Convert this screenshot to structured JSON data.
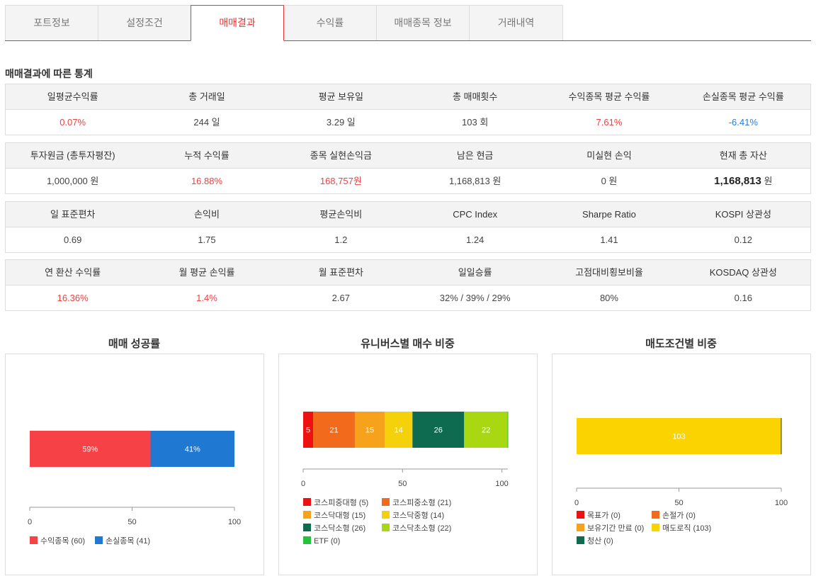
{
  "tabs": [
    {
      "label": "포트정보",
      "active": false
    },
    {
      "label": "설정조건",
      "active": false
    },
    {
      "label": "매매결과",
      "active": true
    },
    {
      "label": "수익률",
      "active": false
    },
    {
      "label": "매매종목 정보",
      "active": false
    },
    {
      "label": "거래내역",
      "active": false
    }
  ],
  "section_title": "매매결과에 따른 통계",
  "stats": [
    {
      "headers": [
        "일평균수익률",
        "총 거래일",
        "평균 보유일",
        "총 매매횟수",
        "수익종목 평균 수익률",
        "손실종목 평균 수익률"
      ],
      "values": [
        {
          "text": "0.07%",
          "style": "red"
        },
        {
          "text": "244 일",
          "style": ""
        },
        {
          "text": "3.29 일",
          "style": ""
        },
        {
          "text": "103 회",
          "style": ""
        },
        {
          "text": "7.61%",
          "style": "red"
        },
        {
          "text": "-6.41%",
          "style": "blue"
        }
      ]
    },
    {
      "headers": [
        "투자원금 (총투자평잔)",
        "누적 수익률",
        "종목 실현손익금",
        "남은 현금",
        "미실현 손익",
        "현재 총 자산"
      ],
      "values": [
        {
          "text": "1,000,000 원",
          "style": ""
        },
        {
          "text": "16.88%",
          "style": "red"
        },
        {
          "text": "168,757원",
          "style": "red"
        },
        {
          "text": "1,168,813 원",
          "style": ""
        },
        {
          "text": "0 원",
          "style": ""
        },
        {
          "text": "1,168,813",
          "unit": " 원",
          "style": "bold"
        }
      ]
    },
    {
      "headers": [
        "일 표준편차",
        "손익비",
        "평균손익비",
        "CPC Index",
        "Sharpe Ratio",
        "KOSPI 상관성"
      ],
      "values": [
        {
          "text": "0.69",
          "style": ""
        },
        {
          "text": "1.75",
          "style": ""
        },
        {
          "text": "1.2",
          "style": ""
        },
        {
          "text": "1.24",
          "style": ""
        },
        {
          "text": "1.41",
          "style": ""
        },
        {
          "text": "0.12",
          "style": ""
        }
      ]
    },
    {
      "headers": [
        "연 환산 수익률",
        "월 평균 손익률",
        "월 표준편차",
        "일일승률",
        "고점대비횡보비율",
        "KOSDAQ 상관성"
      ],
      "values": [
        {
          "text": "16.36%",
          "style": "red"
        },
        {
          "text": "1.4%",
          "style": "red"
        },
        {
          "text": "2.67",
          "style": ""
        },
        {
          "text": "32% / 39% / 29%",
          "style": ""
        },
        {
          "text": "80%",
          "style": ""
        },
        {
          "text": "0.16",
          "style": ""
        }
      ]
    }
  ],
  "charts": [
    {
      "title": "매매 성공률",
      "chart_data": {
        "type": "bar",
        "orientation": "horizontal-stacked",
        "xlim": [
          0,
          100
        ],
        "ticks": [
          0,
          50,
          100
        ],
        "segments": [
          {
            "name": "수익종목",
            "value": 59,
            "count": 60,
            "label": "59%",
            "color": "#f64146"
          },
          {
            "name": "손실종목",
            "value": 41,
            "count": 41,
            "label": "41%",
            "color": "#1f78d1"
          }
        ],
        "legend": [
          "수익종목 (60)",
          "손실종목 (41)"
        ]
      }
    },
    {
      "title": "유니버스별 매수 비중",
      "chart_data": {
        "type": "bar",
        "orientation": "horizontal-stacked",
        "xlim": [
          0,
          103
        ],
        "ticks": [
          0,
          50,
          100
        ],
        "segments": [
          {
            "name": "코스피중대형",
            "value": 5,
            "label": "5",
            "color": "#ee1111"
          },
          {
            "name": "코스피중소형",
            "value": 21,
            "label": "21",
            "color": "#f26a1b"
          },
          {
            "name": "코스닥대형",
            "value": 15,
            "label": "15",
            "color": "#f7a21b"
          },
          {
            "name": "코스닥중형",
            "value": 14,
            "label": "14",
            "color": "#f5d10c"
          },
          {
            "name": "코스닥소형",
            "value": 26,
            "label": "26",
            "color": "#0e6b50"
          },
          {
            "name": "코스닥초소형",
            "value": 22,
            "label": "22",
            "color": "#a8d811"
          },
          {
            "name": "ETF",
            "value": 0,
            "label": "",
            "color": "#27c23c"
          }
        ],
        "legend": [
          "코스피중대형 (5)",
          "코스피중소형 (21)",
          "코스닥대형 (15)",
          "코스닥중형 (14)",
          "코스닥소형 (26)",
          "코스닥초소형 (22)",
          "ETF (0)"
        ]
      }
    },
    {
      "title": "매도조건별 비중",
      "chart_data": {
        "type": "bar",
        "orientation": "horizontal-stacked",
        "xlim": [
          0,
          100
        ],
        "ticks": [
          0,
          50,
          100
        ],
        "segments": [
          {
            "name": "목표가",
            "value": 0,
            "label": "",
            "color": "#ee1111"
          },
          {
            "name": "손절가",
            "value": 0,
            "label": "",
            "color": "#f26a1b"
          },
          {
            "name": "보유기간 만료",
            "value": 0,
            "label": "",
            "color": "#f7a21b"
          },
          {
            "name": "매도로직",
            "value": 100,
            "label": "103",
            "color": "#fad300"
          },
          {
            "name": "청산",
            "value": 0,
            "label": "",
            "color": "#0e6b50"
          }
        ],
        "legend": [
          "목표가 (0)",
          "손절가 (0)",
          "보유기간 만료 (0)",
          "매도로직 (103)",
          "청산 (0)"
        ]
      }
    }
  ]
}
